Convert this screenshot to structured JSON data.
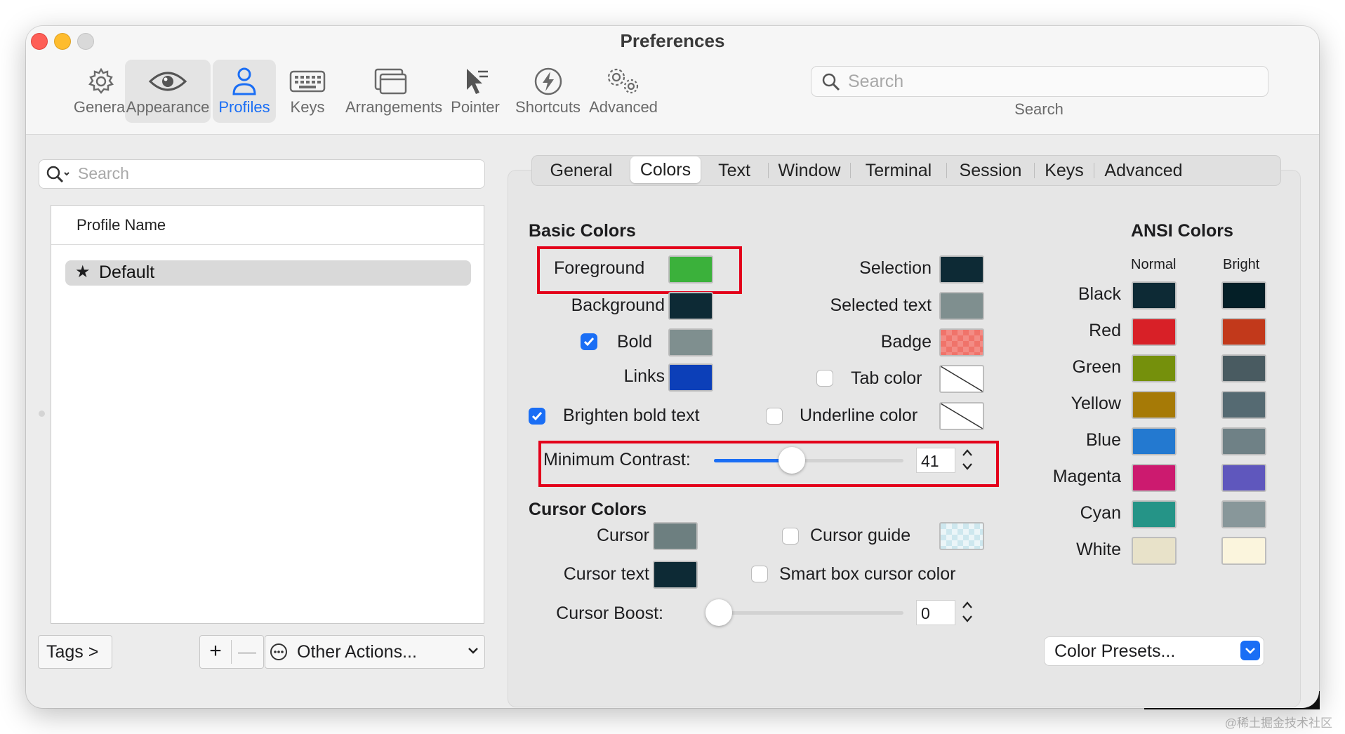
{
  "window": {
    "title": "Preferences"
  },
  "toolbar": {
    "items": [
      {
        "label": "General",
        "icon": "gear-icon"
      },
      {
        "label": "Appearance",
        "icon": "eye-icon"
      },
      {
        "label": "Profiles",
        "icon": "person-icon"
      },
      {
        "label": "Keys",
        "icon": "keyboard-icon"
      },
      {
        "label": "Arrangements",
        "icon": "windows-icon"
      },
      {
        "label": "Pointer",
        "icon": "pointer-icon"
      },
      {
        "label": "Shortcuts",
        "icon": "bolt-icon"
      },
      {
        "label": "Advanced",
        "icon": "gears-icon"
      }
    ],
    "search_placeholder": "Search",
    "search_label": "Search"
  },
  "profiles": {
    "search_placeholder": "Search",
    "column_header": "Profile Name",
    "items": [
      {
        "name": "Default",
        "default": true
      }
    ],
    "tags_button": "Tags >",
    "add": "+",
    "remove": "—",
    "other_actions": "Other Actions..."
  },
  "tabs": [
    "General",
    "Colors",
    "Text",
    "Window",
    "Terminal",
    "Session",
    "Keys",
    "Advanced"
  ],
  "selected_tab": "Colors",
  "basic_colors": {
    "title": "Basic Colors",
    "foreground": {
      "label": "Foreground",
      "color": "#3bb13b"
    },
    "background": {
      "label": "Background",
      "color": "#0d2a35"
    },
    "bold": {
      "label": "Bold",
      "checked": true,
      "color": "#7f8f8f"
    },
    "links": {
      "label": "Links",
      "color": "#0c3fb8"
    },
    "selection": {
      "label": "Selection",
      "color": "#0d2a35"
    },
    "selected_text": {
      "label": "Selected text",
      "color": "#7f8f8f"
    },
    "badge": {
      "label": "Badge",
      "color": "#f0736a"
    },
    "tab_color": {
      "label": "Tab color",
      "checked": false
    },
    "underline_color": {
      "label": "Underline color",
      "checked": false
    },
    "brighten_bold": {
      "label": "Brighten bold text",
      "checked": true
    },
    "min_contrast": {
      "label": "Minimum Contrast:",
      "value": "41",
      "level": 0.41
    }
  },
  "cursor_colors": {
    "title": "Cursor Colors",
    "cursor": {
      "label": "Cursor",
      "color": "#6d7f80"
    },
    "cursor_text": {
      "label": "Cursor text",
      "color": "#0d2a35"
    },
    "cursor_guide": {
      "label": "Cursor guide",
      "checked": false,
      "color": "#cde7ee"
    },
    "smart_box": {
      "label": "Smart box cursor color",
      "checked": false
    },
    "cursor_boost": {
      "label": "Cursor Boost:",
      "value": "0",
      "level": 0
    }
  },
  "ansi": {
    "title": "ANSI Colors",
    "normal_label": "Normal",
    "bright_label": "Bright",
    "rows": [
      {
        "name": "Black",
        "normal": "#0d2a35",
        "bright": "#041f27"
      },
      {
        "name": "Red",
        "normal": "#d82027",
        "bright": "#c2391b"
      },
      {
        "name": "Green",
        "normal": "#75900c",
        "bright": "#495b61"
      },
      {
        "name": "Yellow",
        "normal": "#a67a06",
        "bright": "#556a72"
      },
      {
        "name": "Blue",
        "normal": "#2379d0",
        "bright": "#6f8186"
      },
      {
        "name": "Magenta",
        "normal": "#cc1a6f",
        "bright": "#5f57bd"
      },
      {
        "name": "Cyan",
        "normal": "#259487",
        "bright": "#88979a"
      },
      {
        "name": "White",
        "normal": "#e8e2c9",
        "bright": "#fbf5dd"
      }
    ],
    "presets": "Color Presets..."
  },
  "watermark": "@稀土掘金技术社区"
}
